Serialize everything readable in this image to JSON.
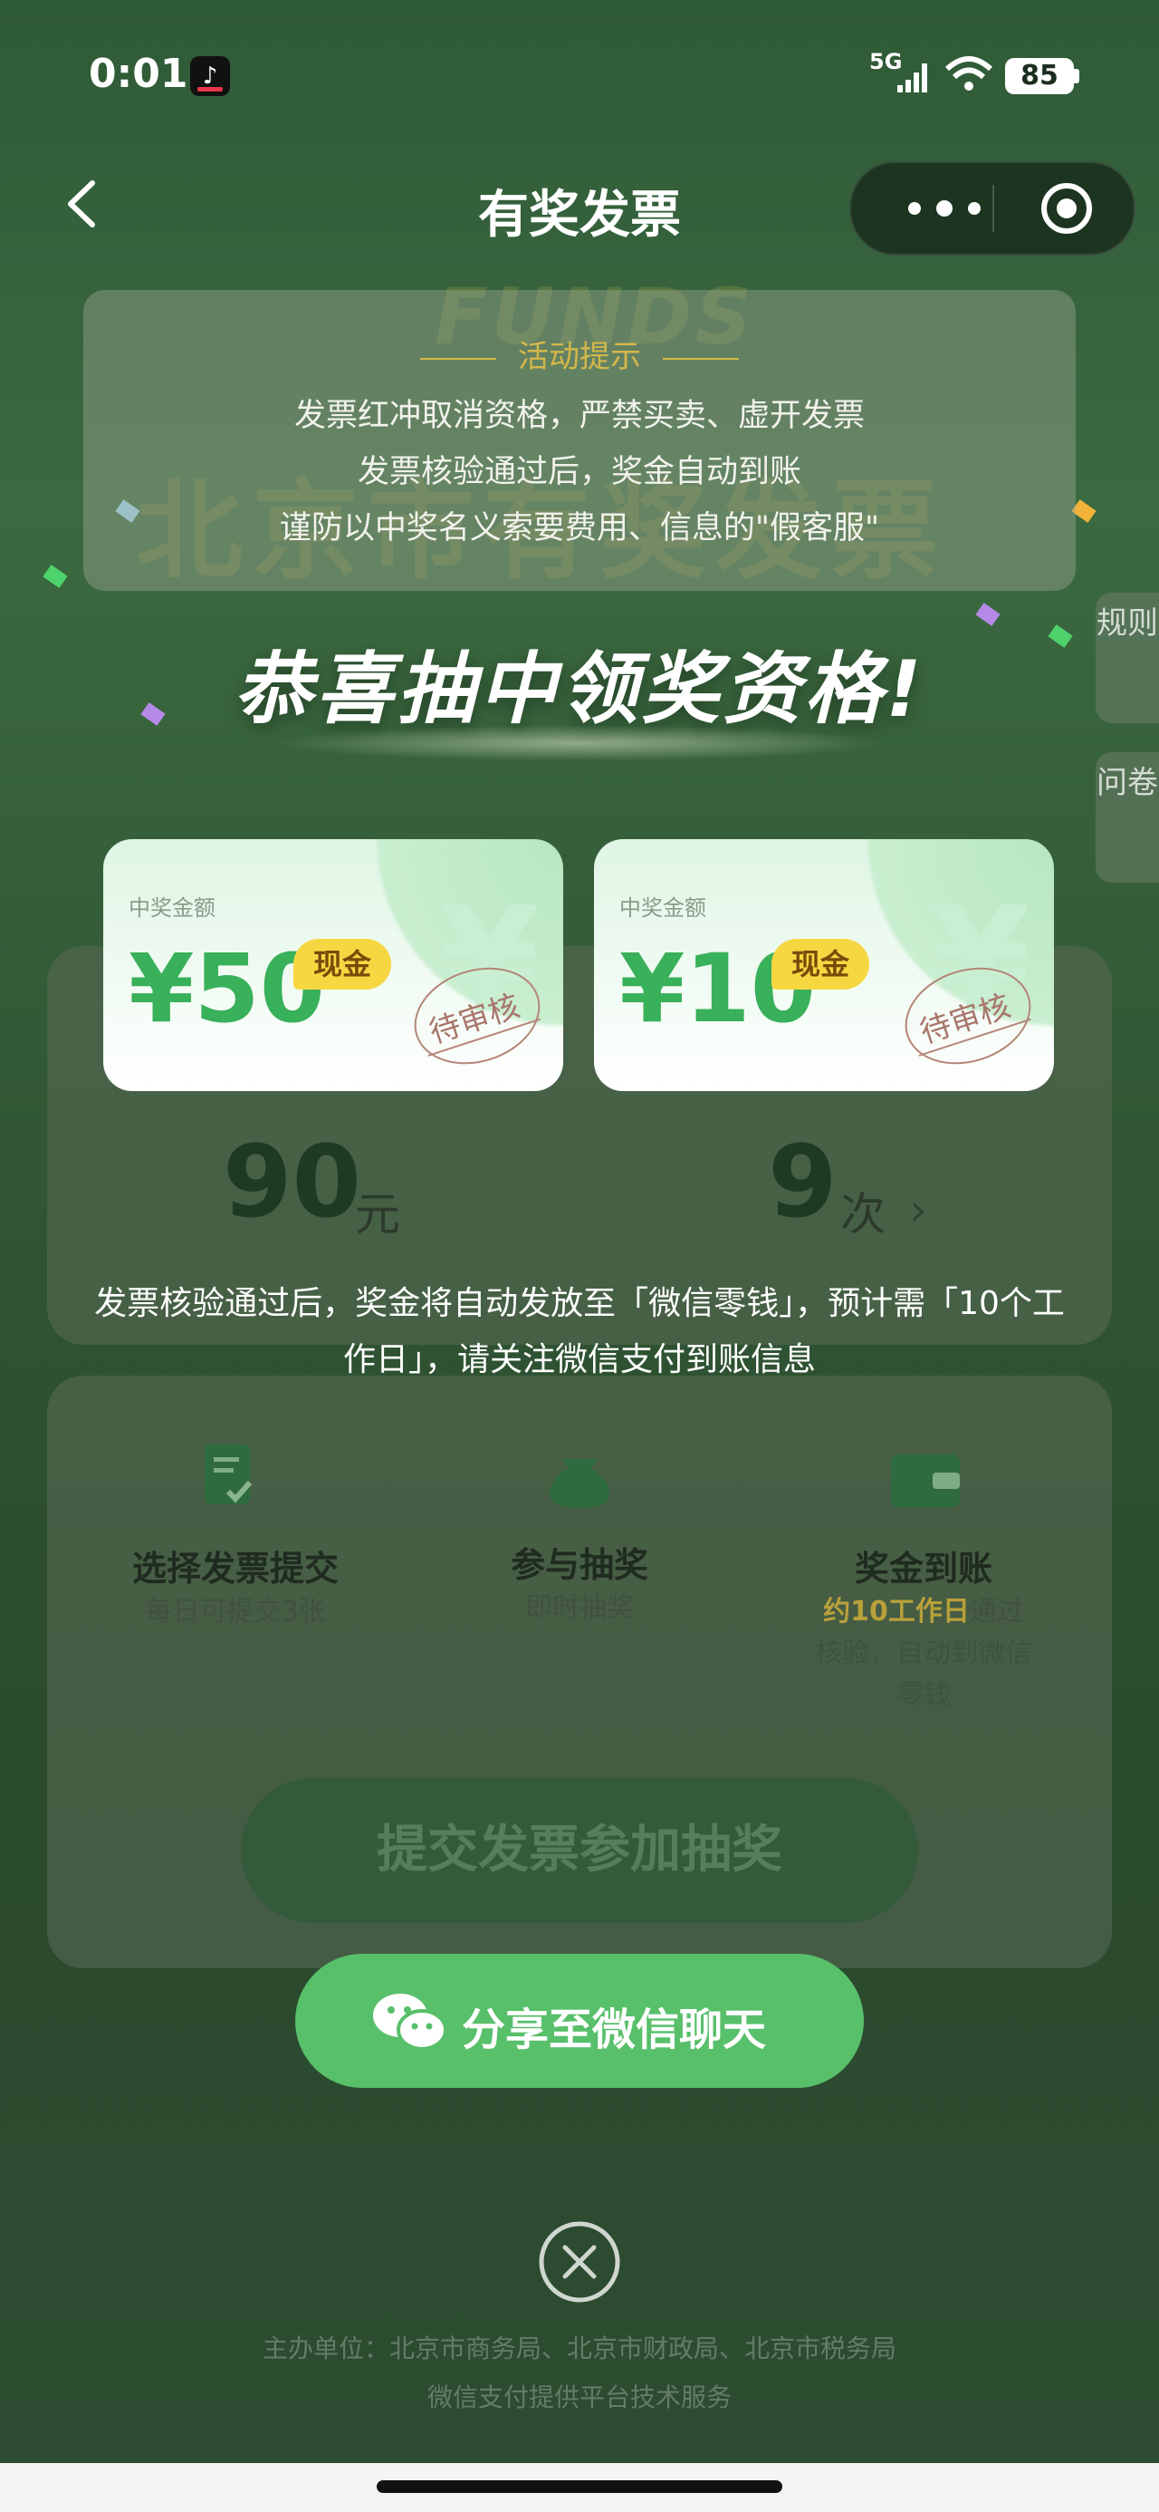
{
  "status_bar": {
    "time": "0:01",
    "network": "5G",
    "battery": "85"
  },
  "nav": {
    "title": "有奖发票"
  },
  "background": {
    "logo": "FUNDS",
    "big_title": "北京市有奖发票"
  },
  "notice": {
    "heading": "活动提示",
    "lines": [
      "发票红冲取消资格，严禁买卖、虚开发票",
      "发票核验通过后，奖金自动到账",
      "谨防以中奖名义索要费用、信息的\"假客服\""
    ]
  },
  "congrats": "恭喜抽中领奖资格!",
  "side_tabs": {
    "rules": "规则",
    "survey": "问卷"
  },
  "prizes": [
    {
      "label": "中奖金额",
      "amount": "¥50",
      "badge": "现金",
      "stamp": "待审核"
    },
    {
      "label": "中奖金额",
      "amount": "¥10",
      "badge": "现金",
      "stamp": "待审核"
    }
  ],
  "summary": {
    "total_value": "90",
    "total_unit": "元",
    "count_value": "9",
    "count_unit": "次"
  },
  "notice_bottom": "发票核验通过后，奖金将自动发放至「微信零钱」，预计需「10个工作日」，请关注微信支付到账信息",
  "steps": [
    {
      "title": "选择发票提交",
      "sub": "每日可提交3张"
    },
    {
      "title": "参与抽奖",
      "sub": "即时抽奖"
    },
    {
      "title": "奖金到账",
      "sub_hl": "约10工作日",
      "sub_rest": "通过核验，自动到微信零钱"
    }
  ],
  "submit_button": "提交发票参加抽奖",
  "share_button": "分享至微信聊天",
  "footer": {
    "organizers": "主办单位：北京市商务局、北京市财政局、北京市税务局",
    "tech": "微信支付提供平台技术服务"
  },
  "colors": {
    "accent_green": "#58bf6a",
    "amount_green": "#39b05a",
    "badge_yellow": "#f6d742",
    "notice_gold": "#d4b74a"
  }
}
